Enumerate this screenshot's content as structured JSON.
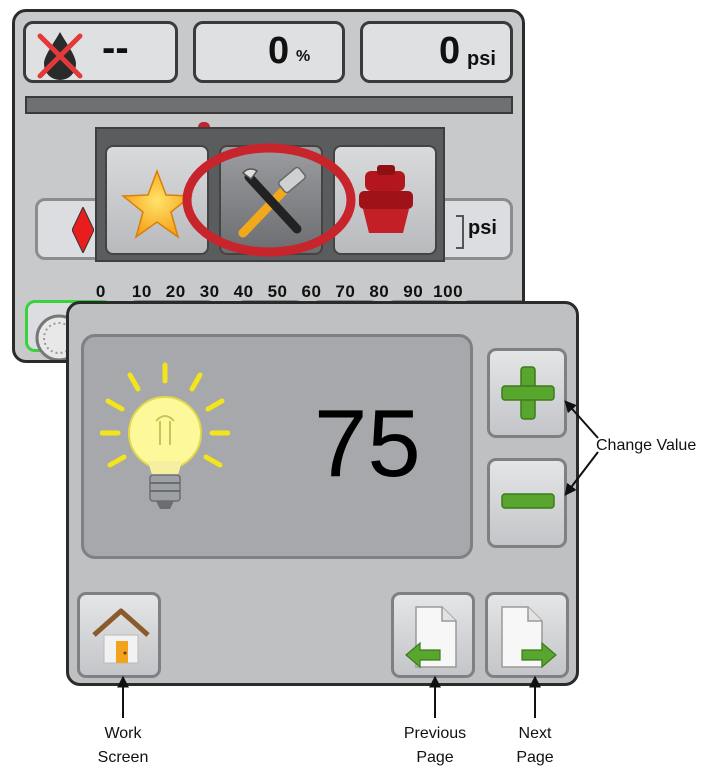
{
  "back_screen": {
    "product_status": "--",
    "rate_value": "0",
    "rate_unit": "%",
    "pressure_value": "0",
    "pressure_unit": "psi",
    "gauge_unit": "psi",
    "gauge_scale": [
      "0",
      "10",
      "20",
      "30",
      "40",
      "50",
      "60",
      "70",
      "80",
      "90",
      "100"
    ]
  },
  "popup_menu": {
    "items": [
      {
        "icon": "star-icon"
      },
      {
        "icon": "tools-icon",
        "selected": true
      },
      {
        "icon": "nozzle-icon"
      }
    ]
  },
  "brightness_panel": {
    "icon": "light-bulb-icon",
    "value": "75",
    "increase_icon": "plus-icon",
    "decrease_icon": "minus-icon"
  },
  "nav": {
    "home_icon": "home-icon",
    "previous_icon": "previous-page-icon",
    "next_icon": "next-page-icon"
  },
  "callouts": {
    "change_value": "Change Value",
    "work_screen_line1": "Work",
    "work_screen_line2": "Screen",
    "previous_page_line1": "Previous",
    "previous_page_line2": "Page",
    "next_page_line1": "Next",
    "next_page_line2": "Page"
  },
  "colors": {
    "highlight_ring": "#c8242b",
    "plus_minus_green": "#58a62e",
    "selection_border": "#39d23c"
  }
}
